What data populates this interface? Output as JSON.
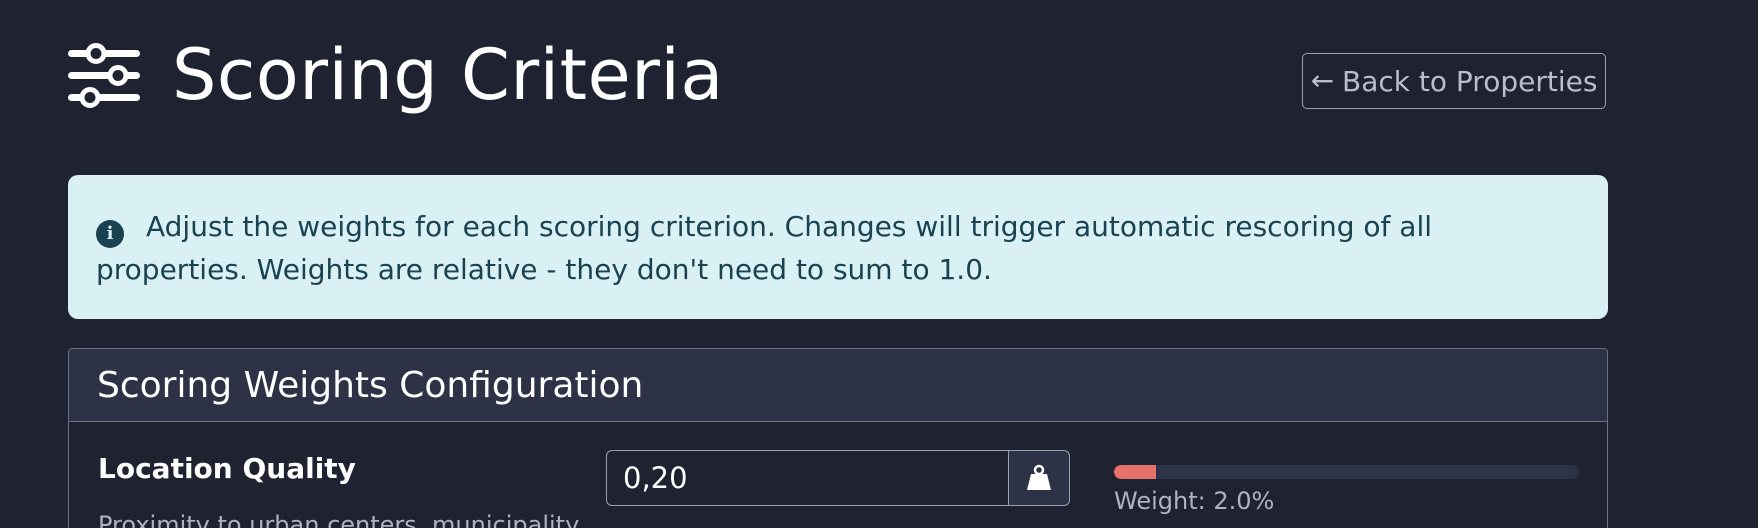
{
  "header": {
    "title": "Scoring Criteria",
    "title_icon": "sliders-icon",
    "back_button_label": "Back to Properties",
    "back_icon": "arrow-left-icon"
  },
  "alert": {
    "icon": "info-circle-icon",
    "text": "Adjust the weights for each scoring criterion. Changes will trigger automatic rescoring of all properties. Weights are relative - they don't need to sum to 1.0."
  },
  "card": {
    "title": "Scoring Weights Configuration",
    "criteria": [
      {
        "name": "Location Quality",
        "description": "Proximity to urban centers, municipality",
        "weight_value": "0,20",
        "addon_icon": "weight-hanging-icon",
        "weight_label": "Weight: 2.0%",
        "weight_fraction": 0.02
      }
    ]
  },
  "colors": {
    "background": "#1f2331",
    "alert_background": "#d9f0f5",
    "alert_text": "#1b4250",
    "progress_fill": "#e8716a",
    "card_header": "#2d3247"
  }
}
